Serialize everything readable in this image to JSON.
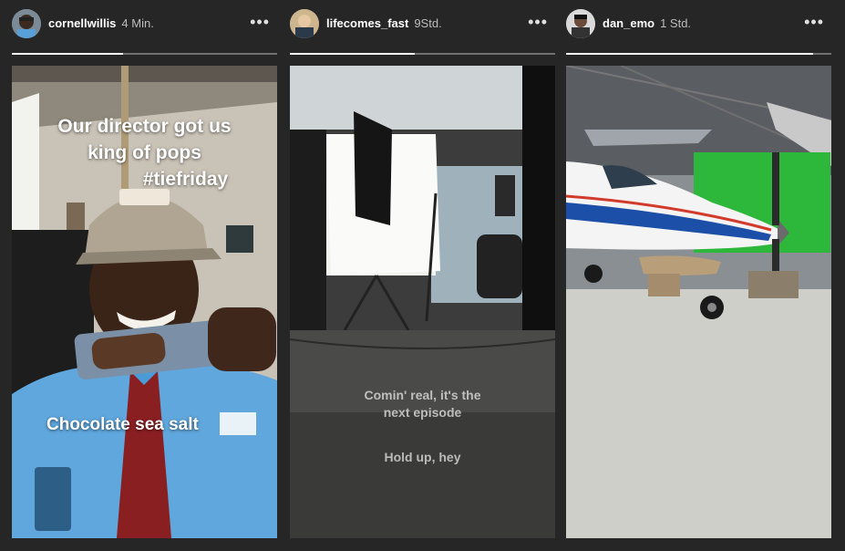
{
  "stories": [
    {
      "username": "cornellwillis",
      "time": "4 Min.",
      "more_label": "•••",
      "progress": 0.42,
      "caption_lines": [
        "Our director got us",
        "king of pops",
        "#tiefriday"
      ],
      "caption2": "Chocolate sea salt"
    },
    {
      "username": "lifecomes_fast",
      "time": "9Std.",
      "more_label": "•••",
      "progress": 0.47,
      "caption_lines": [
        "Comin' real, it's the",
        "next episode"
      ],
      "caption2": "Hold up, hey"
    },
    {
      "username": "dan_emo",
      "time": "1 Std.",
      "more_label": "•••",
      "progress": 0.93
    }
  ]
}
